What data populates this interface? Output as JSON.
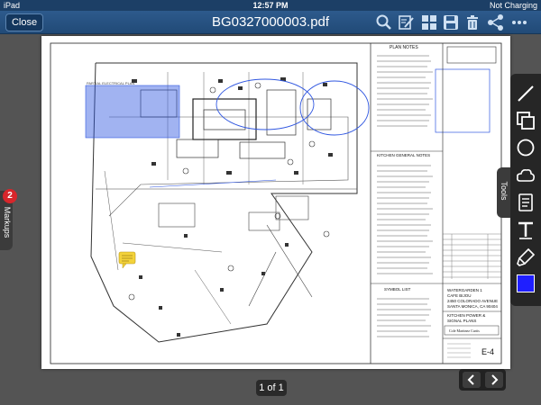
{
  "status": {
    "carrier": "iPad",
    "time": "12:57 PM",
    "battery": "Not Charging"
  },
  "toolbar": {
    "close_label": "Close",
    "document_title": "BG0327000003.pdf",
    "icons": [
      "search-icon",
      "annotate-icon",
      "thumbnails-icon",
      "save-icon",
      "trash-icon",
      "share-icon",
      "more-icon"
    ]
  },
  "markups": {
    "count": "2",
    "label": "Markups"
  },
  "tools": {
    "label": "Tools",
    "items": [
      "line-tool",
      "rectangle-tool",
      "ellipse-tool",
      "cloud-tool",
      "note-tool",
      "text-tool",
      "highlighter-tool",
      "color-swatch"
    ],
    "active_color": "#1f1fff"
  },
  "pager": {
    "label": "1 of 1"
  },
  "drawing": {
    "plan_notes": "PLAN NOTES",
    "kitchen_notes": "KITCHEN GENERAL NOTES",
    "symbol_list": "SYMBOL LIST",
    "project_lines": [
      "WATERGARDEN 1",
      "CAFE BIJOU",
      "2450 COLORADO AVENUE",
      "SANTA MONICA, CA 90404"
    ],
    "sheet_title": [
      "KITCHEN POWER &",
      "SIGNAL PLANS"
    ],
    "firm": "Cole Martinez Curtis",
    "sheet_number": "E-4",
    "partial_plan_label": "PARTIAL ELECTRICAL PLAN"
  },
  "colors": {
    "toolbar": "#2d5a8c",
    "markup_blue": "#2f56e0",
    "note_yellow": "#f3d23a"
  }
}
